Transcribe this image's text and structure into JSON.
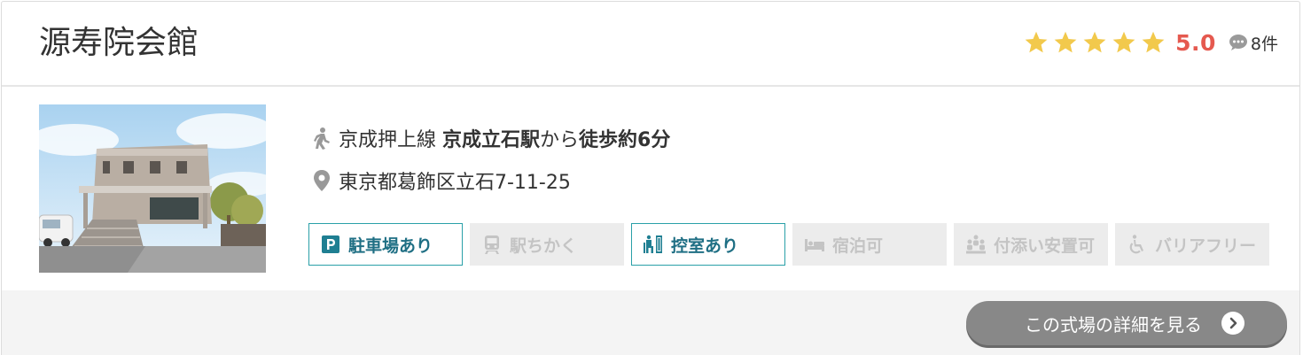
{
  "hall": {
    "name": "源寿院会館",
    "rating": {
      "stars_filled": 5,
      "stars_total": 5,
      "score": "5.0",
      "review_count": "8件",
      "star_color": "#f2c94c",
      "score_color": "#e5594f"
    }
  },
  "info": {
    "access": {
      "icon": "walking-person-icon",
      "line": "京成押上線 ",
      "station": "京成立石駅",
      "from": "から",
      "walk": "徒歩約6分"
    },
    "address": {
      "icon": "map-pin-icon",
      "text": "東京都葛飾区立石7-11-25"
    }
  },
  "features": [
    {
      "label": "駐車場あり",
      "icon": "parking-icon",
      "available": true
    },
    {
      "label": "駅ちかく",
      "icon": "train-icon",
      "available": false
    },
    {
      "label": "控室あり",
      "icon": "waiting-room-icon",
      "available": true
    },
    {
      "label": "宿泊可",
      "icon": "bed-icon",
      "available": false
    },
    {
      "label": "付添い安置可",
      "icon": "people-group-icon",
      "available": false
    },
    {
      "label": "バリアフリー",
      "icon": "wheelchair-icon",
      "available": false
    }
  ],
  "footer": {
    "detail_button_label": "この式場の詳細を見る",
    "detail_button_icon": "chevron-right-circle-icon"
  },
  "colors": {
    "accent_teal": "#2aa0a8",
    "button_gray": "#888888",
    "footer_bg": "#f4f4f4"
  }
}
